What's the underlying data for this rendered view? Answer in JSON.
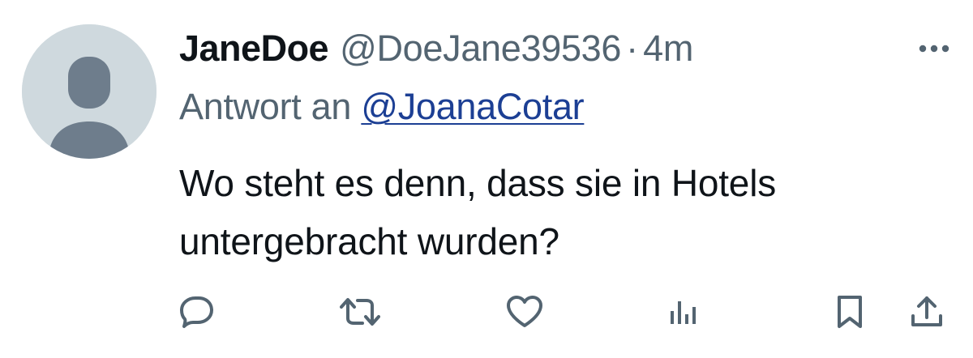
{
  "tweet": {
    "display_name": "JaneDoe",
    "handle": "@DoeJane39536",
    "separator": "·",
    "time": "4m",
    "reply_prefix": "Antwort an ",
    "reply_to_handle": "@JoanaCotar",
    "text_line1": "Wo steht es denn, dass sie in Hotels",
    "text_line2": "untergebracht wurden?"
  },
  "colors": {
    "text_primary": "#0f1419",
    "text_secondary": "#536471",
    "link": "#1c3f94",
    "avatar_bg": "#cfd9de",
    "avatar_figure": "#6e7d8c"
  },
  "actions": [
    {
      "name": "reply",
      "icon": "speech-bubble-icon"
    },
    {
      "name": "repost",
      "icon": "repost-arrows-icon"
    },
    {
      "name": "like",
      "icon": "heart-icon"
    },
    {
      "name": "views",
      "icon": "bar-chart-icon"
    },
    {
      "name": "bookmark",
      "icon": "bookmark-icon"
    },
    {
      "name": "share",
      "icon": "upload-icon"
    }
  ]
}
